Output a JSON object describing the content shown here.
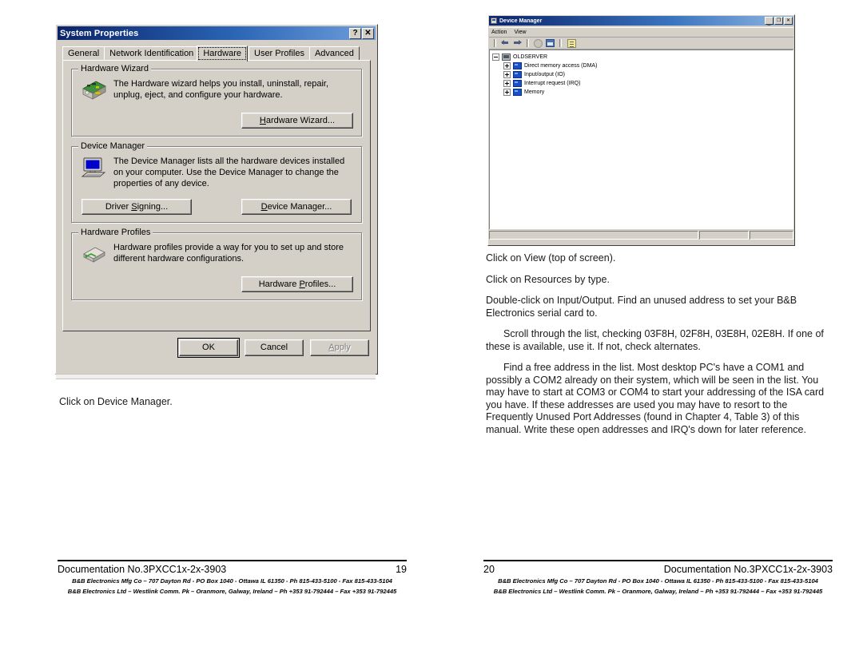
{
  "document": {
    "left_page": {
      "caption": "Click on Device Manager.",
      "footer": {
        "title": "Documentation No.3PXCC1x-2x-3903",
        "page_number": "19",
        "address_line_1": "B&B Electronics Mfg Co – 707 Dayton Rd - PO Box 1040 - Ottawa IL 61350 - Ph 815-433-5100 - Fax 815-433-5104",
        "address_line_2": "B&B Electronics Ltd – Westlink Comm. Pk – Oranmore, Galway, Ireland – Ph +353 91-792444 – Fax +353 91-792445"
      }
    },
    "right_page": {
      "paragraphs": [
        "Click on View (top of screen).",
        "Click on Resources by type.",
        "Double-click on Input/Output. Find an unused address to set your B&B Electronics serial card to."
      ],
      "indented_paragraphs": [
        "Scroll through the list, checking 03F8H, 02F8H, 03E8H, 02E8H. If one of these is available, use it. If not, check alternates.",
        "Find a free address in the list. Most desktop PC's have a COM1 and possibly a COM2 already on their system, which will be seen in the list. You may have to start at COM3 or COM4 to start your addressing of the ISA card you have. If these addresses are used you may have to resort to the Frequently Unused Port Addresses (found in Chapter 4, Table 3) of this manual. Write these open addresses and IRQ's down for later reference."
      ],
      "footer": {
        "title": "Documentation No.3PXCC1x-2x-3903",
        "page_number": "20",
        "address_line_1": "B&B Electronics Mfg Co – 707 Dayton Rd - PO Box 1040 - Ottawa IL 61350 - Ph 815-433-5100 - Fax 815-433-5104",
        "address_line_2": "B&B Electronics Ltd – Westlink Comm. Pk – Oranmore, Galway, Ireland – Ph +353 91-792444 – Fax +353 91-792445"
      }
    }
  },
  "system_properties": {
    "title": "System Properties",
    "titlebar_buttons": [
      {
        "name": "help-button",
        "glyph": "?"
      },
      {
        "name": "close-button",
        "glyph": "✕"
      }
    ],
    "tabs": [
      {
        "label": "General",
        "active": false
      },
      {
        "label": "Network Identification",
        "active": false
      },
      {
        "label": "Hardware",
        "active": true
      },
      {
        "label": "User Profiles",
        "active": false
      },
      {
        "label": "Advanced",
        "active": false
      }
    ],
    "groups": [
      {
        "title": "Hardware Wizard",
        "icon": "hardware-card-icon",
        "description": "The Hardware wizard helps you install, uninstall, repair, unplug, eject, and configure your hardware.",
        "buttons": [
          {
            "label": "Hardware Wizard...",
            "accel": "H",
            "name": "hardware-wizard-button",
            "disabled": false
          }
        ]
      },
      {
        "title": "Device Manager",
        "icon": "computer-monitor-icon",
        "description": "The Device Manager lists all the hardware devices installed on your computer. Use the Device Manager to change the properties of any device.",
        "buttons": [
          {
            "label": "Driver Signing...",
            "accel": "S",
            "name": "driver-signing-button",
            "disabled": false
          },
          {
            "label": "Device Manager...",
            "accel": "D",
            "name": "device-manager-button",
            "disabled": false
          }
        ]
      },
      {
        "title": "Hardware Profiles",
        "icon": "hardware-profile-icon",
        "description": "Hardware profiles provide a way for you to set up and store different hardware configurations.",
        "buttons": [
          {
            "label": "Hardware Profiles...",
            "accel": "P",
            "name": "hardware-profiles-button",
            "disabled": false
          }
        ]
      }
    ],
    "footer_buttons": [
      {
        "label": "OK",
        "name": "ok-button",
        "disabled": false,
        "default": true
      },
      {
        "label": "Cancel",
        "name": "cancel-button",
        "disabled": false,
        "default": false
      },
      {
        "label": "Apply",
        "accel": "A",
        "name": "apply-button",
        "disabled": true,
        "default": false
      }
    ]
  },
  "device_manager": {
    "title": "Device Manager",
    "titlebar_buttons": [
      {
        "name": "minimize-button",
        "glyph": "_"
      },
      {
        "name": "maximize-button",
        "glyph": "❐"
      },
      {
        "name": "close-button",
        "glyph": "✕"
      }
    ],
    "menus": [
      {
        "label": "Action",
        "name": "menu-action"
      },
      {
        "label": "View",
        "name": "menu-view"
      }
    ],
    "toolbar_icons": [
      "back-arrow-icon",
      "forward-arrow-icon",
      "up-one-level-icon",
      "show-hide-tree-icon",
      "properties-icon"
    ],
    "tree": {
      "root": {
        "label": "OLDSERVER",
        "expanded": true
      },
      "children": [
        {
          "label": "Direct memory access (DMA)",
          "expanded": false
        },
        {
          "label": "Input/output (IO)",
          "expanded": false
        },
        {
          "label": "Interrupt request (IRQ)",
          "expanded": false
        },
        {
          "label": "Memory",
          "expanded": false
        }
      ]
    },
    "status_panes": [
      "",
      "",
      ""
    ]
  }
}
